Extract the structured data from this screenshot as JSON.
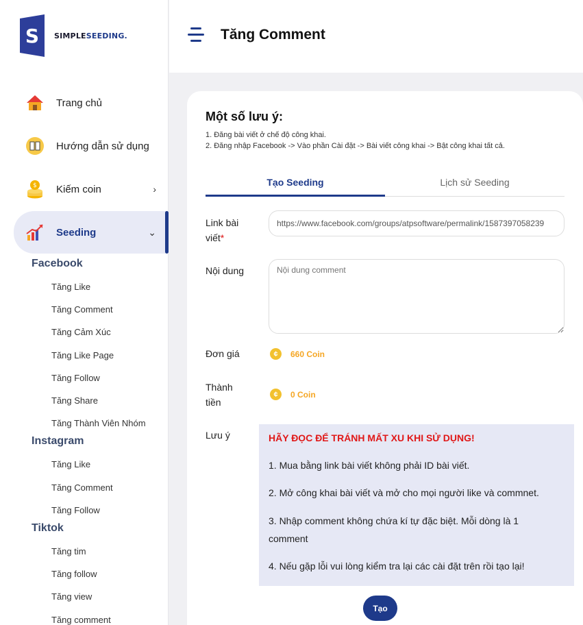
{
  "brand": {
    "name_a": "SIMPLE",
    "name_b": "SEEDING.",
    "mark_letter": "S",
    "color": "#1e3a8a"
  },
  "header": {
    "title": "Tăng Comment"
  },
  "sidebar": {
    "items": [
      {
        "label": "Trang chủ",
        "icon": "home-icon"
      },
      {
        "label": "Hướng dẫn sử dụng",
        "icon": "book-icon"
      },
      {
        "label": "Kiếm coin",
        "icon": "coins-icon",
        "chevron": "›"
      },
      {
        "label": "Seeding",
        "icon": "growth-chart-icon",
        "chevron": "⌄"
      }
    ],
    "groups": [
      {
        "title": "Facebook",
        "items": [
          "Tăng Like",
          "Tăng Comment",
          "Tăng Cảm Xúc",
          "Tăng Like Page",
          "Tăng Follow",
          "Tăng Share",
          "Tăng Thành Viên Nhóm"
        ]
      },
      {
        "title": "Instagram",
        "items": [
          "Tăng Like",
          "Tăng Comment",
          "Tăng Follow"
        ]
      },
      {
        "title": "Tiktok",
        "items": [
          "Tăng tim",
          "Tăng follow",
          "Tăng view",
          "Tăng comment"
        ]
      }
    ]
  },
  "notes": {
    "title": "Một số lưu ý:",
    "lines": [
      "1. Đăng bài viết ở chế độ công khai.",
      "2. Đăng nhập Facebook -> Vào phần Cài đặt -> Bài viết công khai -> Bật công khai tất cả."
    ]
  },
  "tabs": [
    "Tạo Seeding",
    "Lịch sử Seeding"
  ],
  "form": {
    "link_label_1": "Link bài",
    "link_label_2": "viết",
    "required_mark": "*",
    "link_value": "https://www.facebook.com/groups/atpsoftware/permalink/1587397058239",
    "content_label": "Nội dung",
    "content_placeholder": "Nội dung comment",
    "price_label": "Đơn giá",
    "price_value": "660 Coin",
    "total_label_1": "Thành",
    "total_label_2": "tiền",
    "total_value": "0 Coin",
    "coin_symbol": "¢",
    "note_label": "Lưu ý"
  },
  "warning": {
    "title": "HÃY ĐỌC ĐỂ TRÁNH MẤT XU KHI SỬ DỤNG!",
    "lines": [
      "1. Mua bằng link bài viết không phải ID bài viết.",
      "2. Mở công khai bài viết và mở cho mọi người like và commnet.",
      "3. Nhập comment không chứa kí tự đặc biệt. Mỗi dòng là 1 comment",
      "4. Nếu gặp lỗi vui lòng kiểm tra lại các cài đặt trên rồi tạo lại!"
    ]
  },
  "submit_label": "Tạo"
}
